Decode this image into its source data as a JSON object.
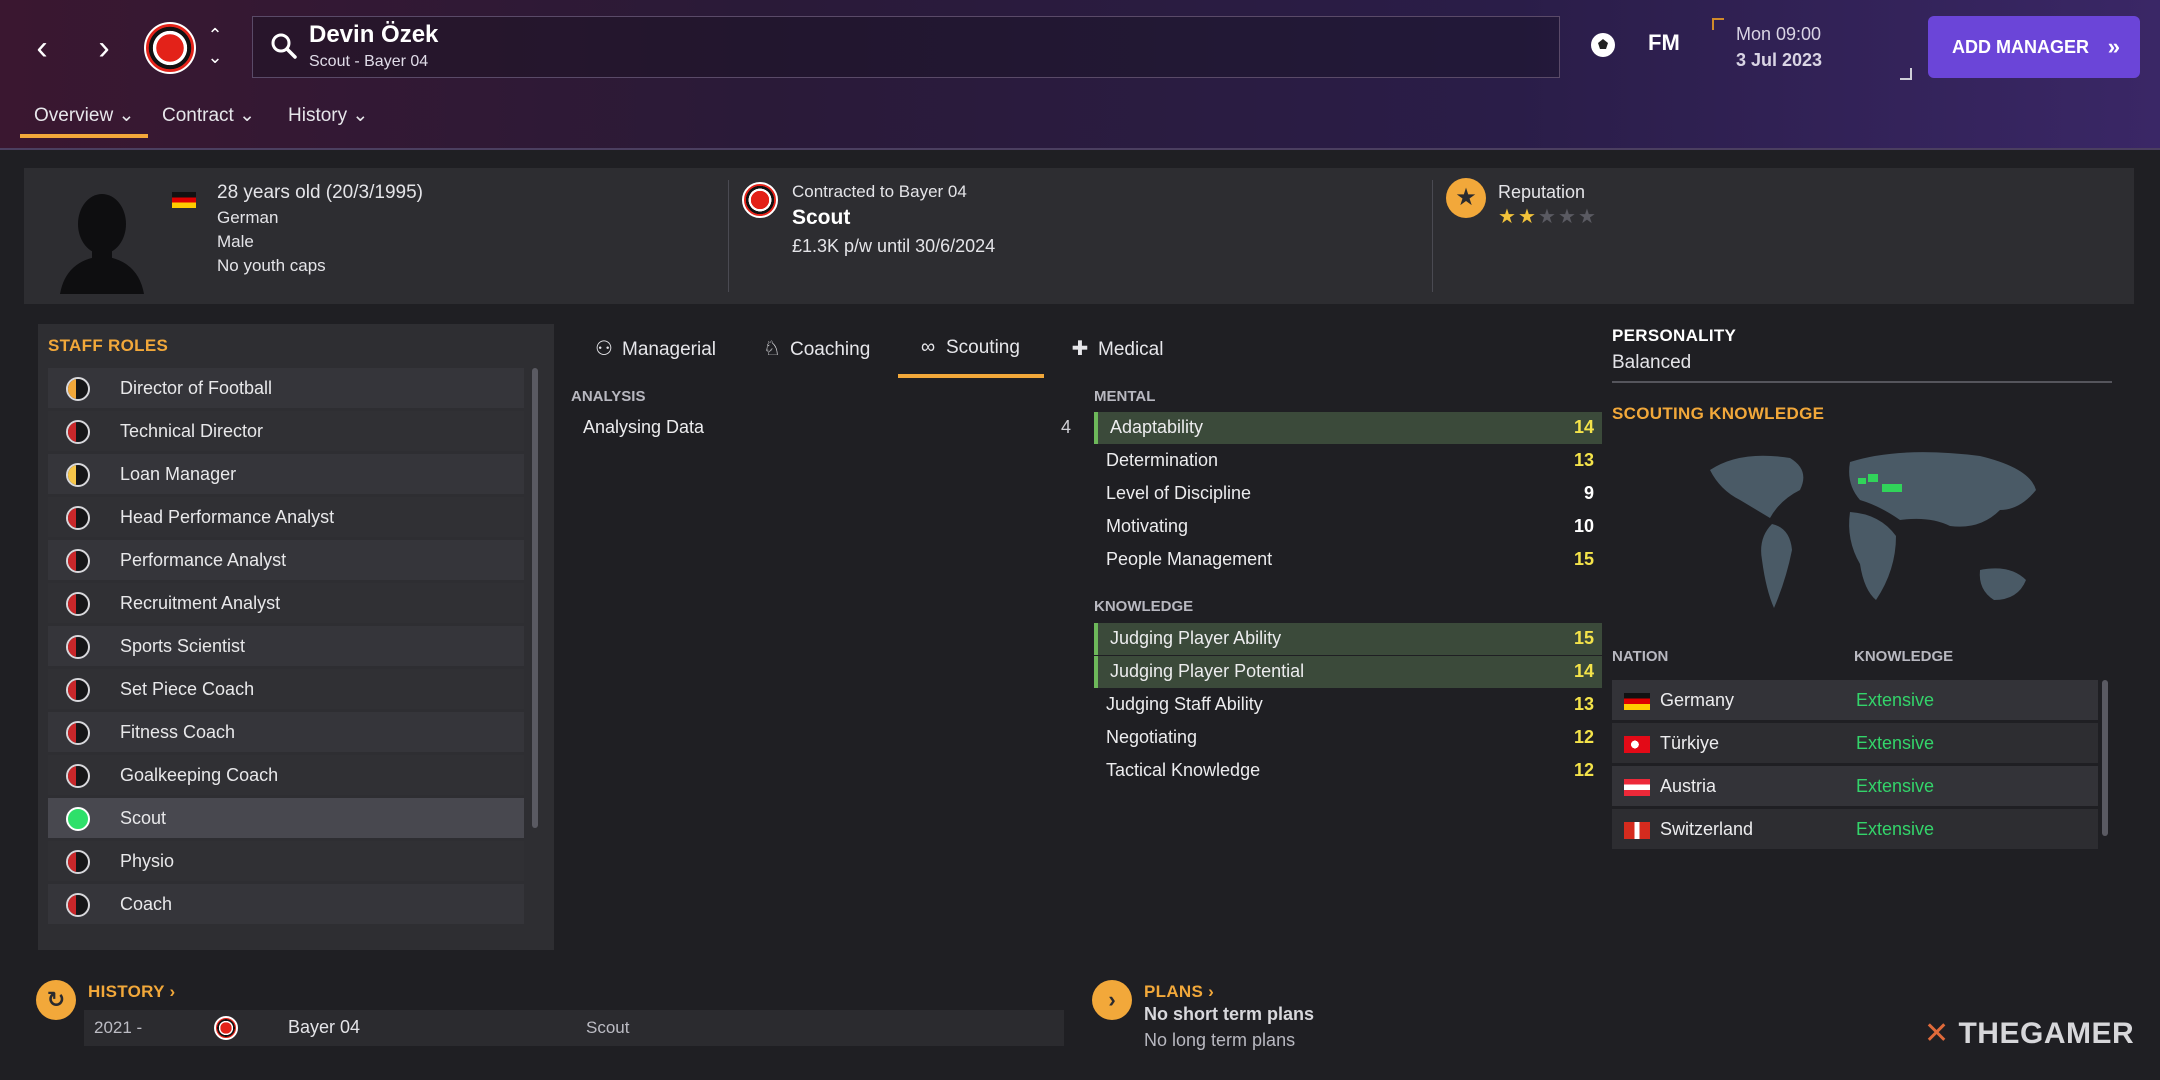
{
  "header": {
    "person_name": "Devin Özek",
    "person_sub": "Scout - Bayer 04",
    "fm_label": "FM",
    "date_day": "Mon 09:00",
    "date_date": "3 Jul 2023",
    "add_manager": "ADD MANAGER"
  },
  "nav_tabs": [
    {
      "label": "Overview"
    },
    {
      "label": "Contract"
    },
    {
      "label": "History"
    }
  ],
  "profile": {
    "age": "28 years old (20/3/1995)",
    "nationality": "German",
    "gender": "Male",
    "youth_caps": "No youth caps",
    "contract_to": "Contracted to Bayer 04",
    "role": "Scout",
    "wage": "£1.3K p/w until 30/6/2024",
    "reputation_label": "Reputation",
    "reputation_stars": 2,
    "reputation_max": 5
  },
  "staff_roles": {
    "title": "STAFF ROLES",
    "items": [
      {
        "label": "Director of Football",
        "fill": "#f2a83a"
      },
      {
        "label": "Technical Director",
        "fill": "#c8272a"
      },
      {
        "label": "Loan Manager",
        "fill": "#f6c64a"
      },
      {
        "label": "Head Performance Analyst",
        "fill": "#c8272a"
      },
      {
        "label": "Performance Analyst",
        "fill": "#c8272a"
      },
      {
        "label": "Recruitment Analyst",
        "fill": "#c8272a"
      },
      {
        "label": "Sports Scientist",
        "fill": "#c8272a"
      },
      {
        "label": "Set Piece Coach",
        "fill": "#c8272a"
      },
      {
        "label": "Fitness Coach",
        "fill": "#c8272a"
      },
      {
        "label": "Goalkeeping Coach",
        "fill": "#c8272a"
      },
      {
        "label": "Scout",
        "fill": "#2ee06a"
      },
      {
        "label": "Physio",
        "fill": "#c8272a"
      },
      {
        "label": "Coach",
        "fill": "#c8272a"
      }
    ]
  },
  "attr_tabs": [
    {
      "label": "Managerial"
    },
    {
      "label": "Coaching"
    },
    {
      "label": "Scouting"
    },
    {
      "label": "Medical"
    }
  ],
  "analysis": {
    "label": "ANALYSIS",
    "items": [
      {
        "name": "Analysing Data",
        "value": "4"
      }
    ]
  },
  "mental": {
    "label": "MENTAL",
    "items": [
      {
        "name": "Adaptability",
        "value": "14"
      },
      {
        "name": "Determination",
        "value": "13"
      },
      {
        "name": "Level of Discipline",
        "value": "9"
      },
      {
        "name": "Motivating",
        "value": "10"
      },
      {
        "name": "People Management",
        "value": "15"
      }
    ]
  },
  "knowledge": {
    "label": "KNOWLEDGE",
    "items": [
      {
        "name": "Judging Player Ability",
        "value": "15"
      },
      {
        "name": "Judging Player Potential",
        "value": "14"
      },
      {
        "name": "Judging Staff Ability",
        "value": "13"
      },
      {
        "name": "Negotiating",
        "value": "12"
      },
      {
        "name": "Tactical Knowledge",
        "value": "12"
      }
    ]
  },
  "personality": {
    "label": "PERSONALITY",
    "value": "Balanced"
  },
  "scouting_knowledge": {
    "title": "SCOUTING KNOWLEDGE",
    "col_nation": "NATION",
    "col_knowledge": "KNOWLEDGE",
    "nations": [
      {
        "name": "Germany",
        "level": "Extensive"
      },
      {
        "name": "Türkiye",
        "level": "Extensive"
      },
      {
        "name": "Austria",
        "level": "Extensive"
      },
      {
        "name": "Switzerland",
        "level": "Extensive"
      }
    ]
  },
  "history": {
    "title": "HISTORY",
    "rows": [
      {
        "years": "2021 -",
        "club": "Bayer 04",
        "role": "Scout"
      }
    ]
  },
  "plans": {
    "title": "PLANS",
    "short": "No short term plans",
    "long": "No long term plans"
  },
  "watermark": "THEGAMER"
}
